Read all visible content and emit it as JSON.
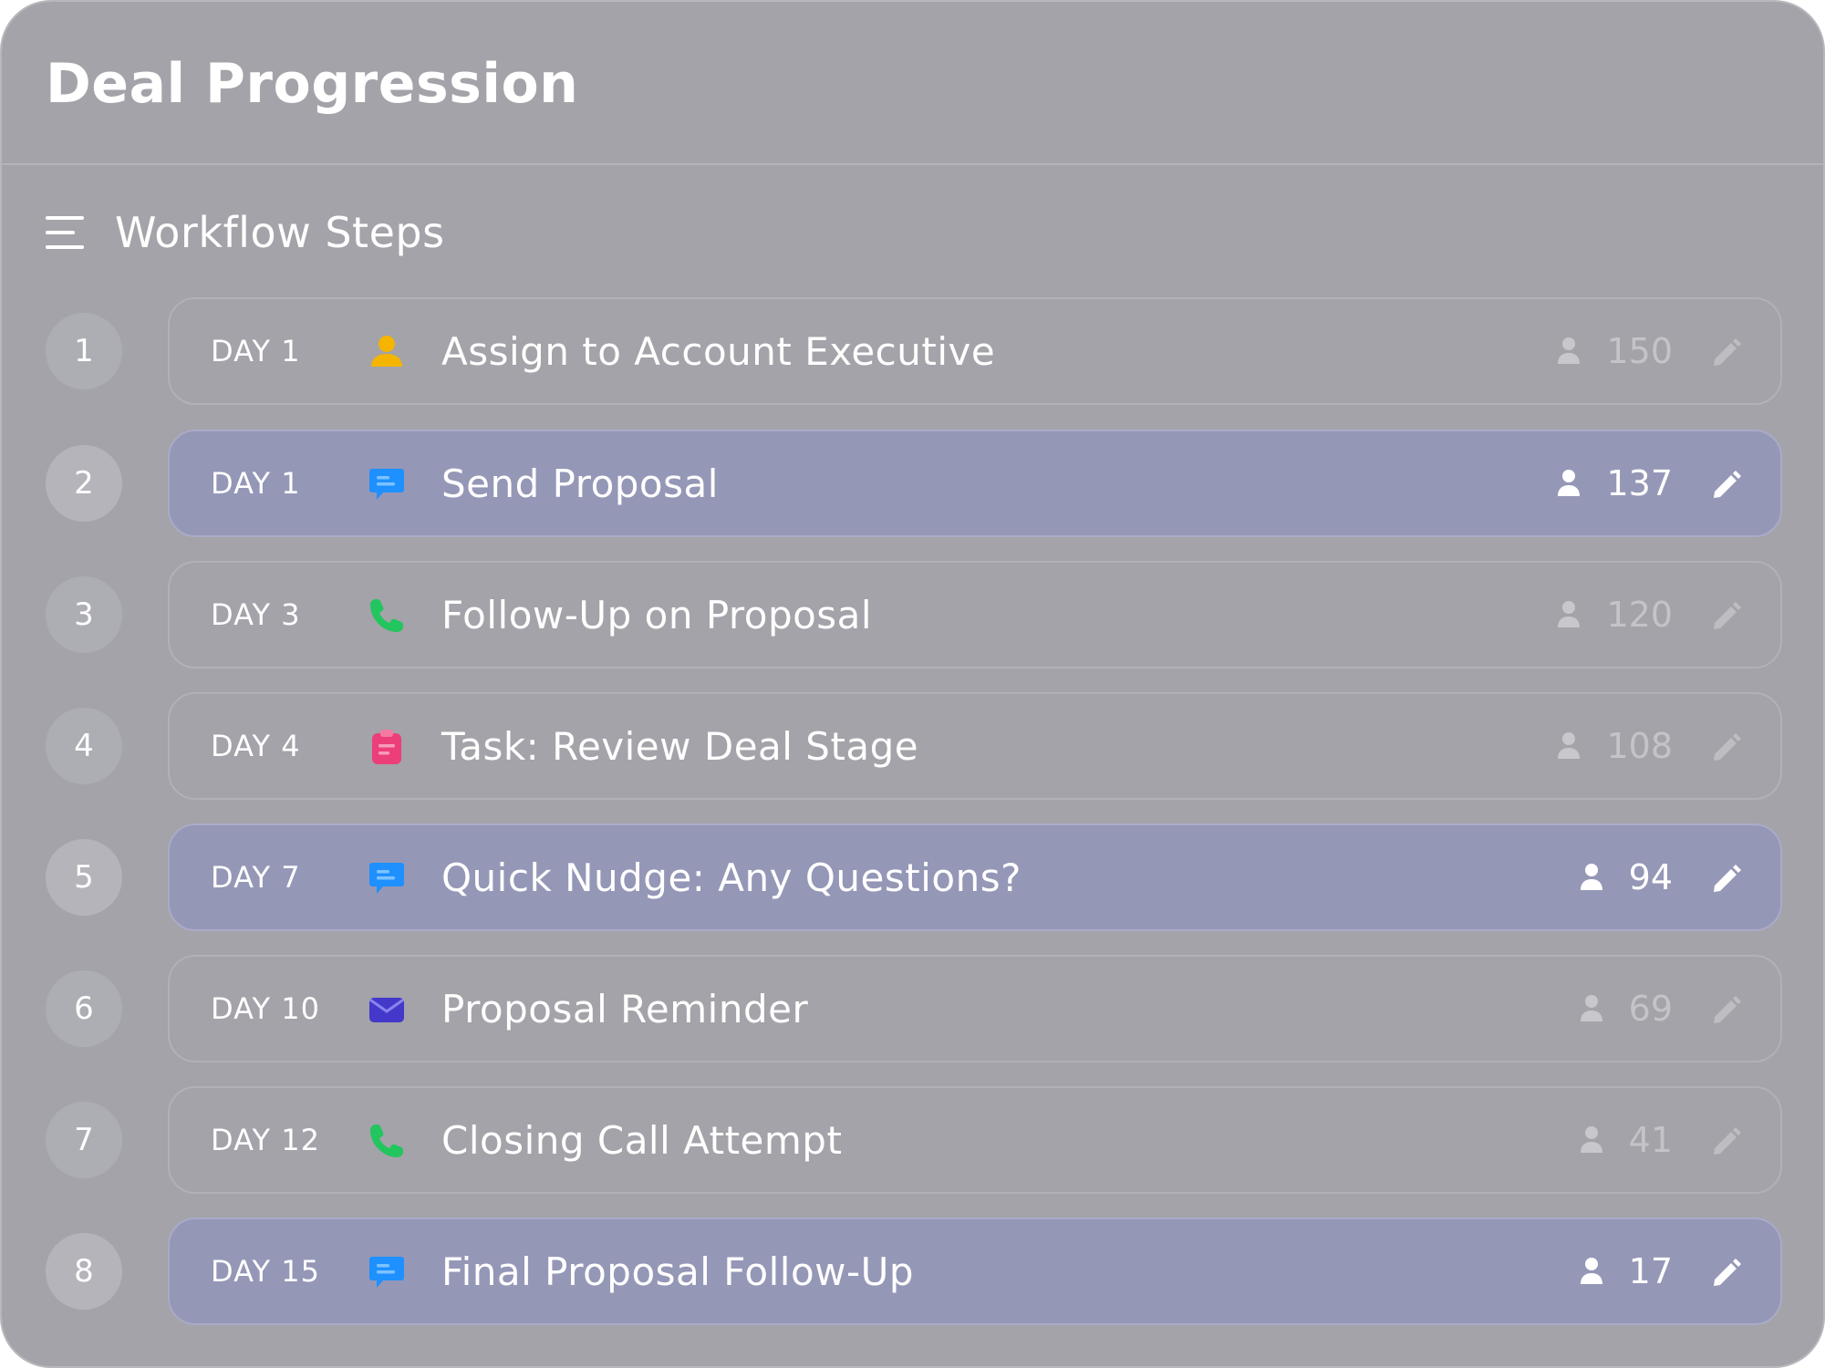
{
  "header": {
    "title": "Deal Progression"
  },
  "section": {
    "title": "Workflow Steps",
    "icon": "menu-lines-icon"
  },
  "colors": {
    "panel": "#a3a3a9",
    "active_card": "#9597b7",
    "assign": "#f5b400",
    "message": "#1e90ff",
    "call": "#22c55e",
    "task": "#ec3f7a",
    "email": "#4338ca"
  },
  "steps": [
    {
      "number": "1",
      "day": "DAY 1",
      "icon": "person-icon",
      "title": "Assign to Account Executive",
      "count": "150",
      "active": false
    },
    {
      "number": "2",
      "day": "DAY 1",
      "icon": "message-icon",
      "title": "Send Proposal",
      "count": "137",
      "active": true
    },
    {
      "number": "3",
      "day": "DAY 3",
      "icon": "phone-icon",
      "title": "Follow-Up on Proposal",
      "count": "120",
      "active": false
    },
    {
      "number": "4",
      "day": "DAY 4",
      "icon": "clipboard-icon",
      "title": "Task: Review Deal Stage",
      "count": "108",
      "active": false
    },
    {
      "number": "5",
      "day": "DAY 7",
      "icon": "message-icon",
      "title": "Quick Nudge: Any Questions?",
      "count": "94",
      "active": true
    },
    {
      "number": "6",
      "day": "DAY 10",
      "icon": "envelope-icon",
      "title": "Proposal Reminder",
      "count": "69",
      "active": false
    },
    {
      "number": "7",
      "day": "DAY 12",
      "icon": "phone-icon",
      "title": "Closing Call Attempt",
      "count": "41",
      "active": false
    },
    {
      "number": "8",
      "day": "DAY 15",
      "icon": "message-icon",
      "title": "Final Proposal Follow-Up",
      "count": "17",
      "active": true
    }
  ]
}
